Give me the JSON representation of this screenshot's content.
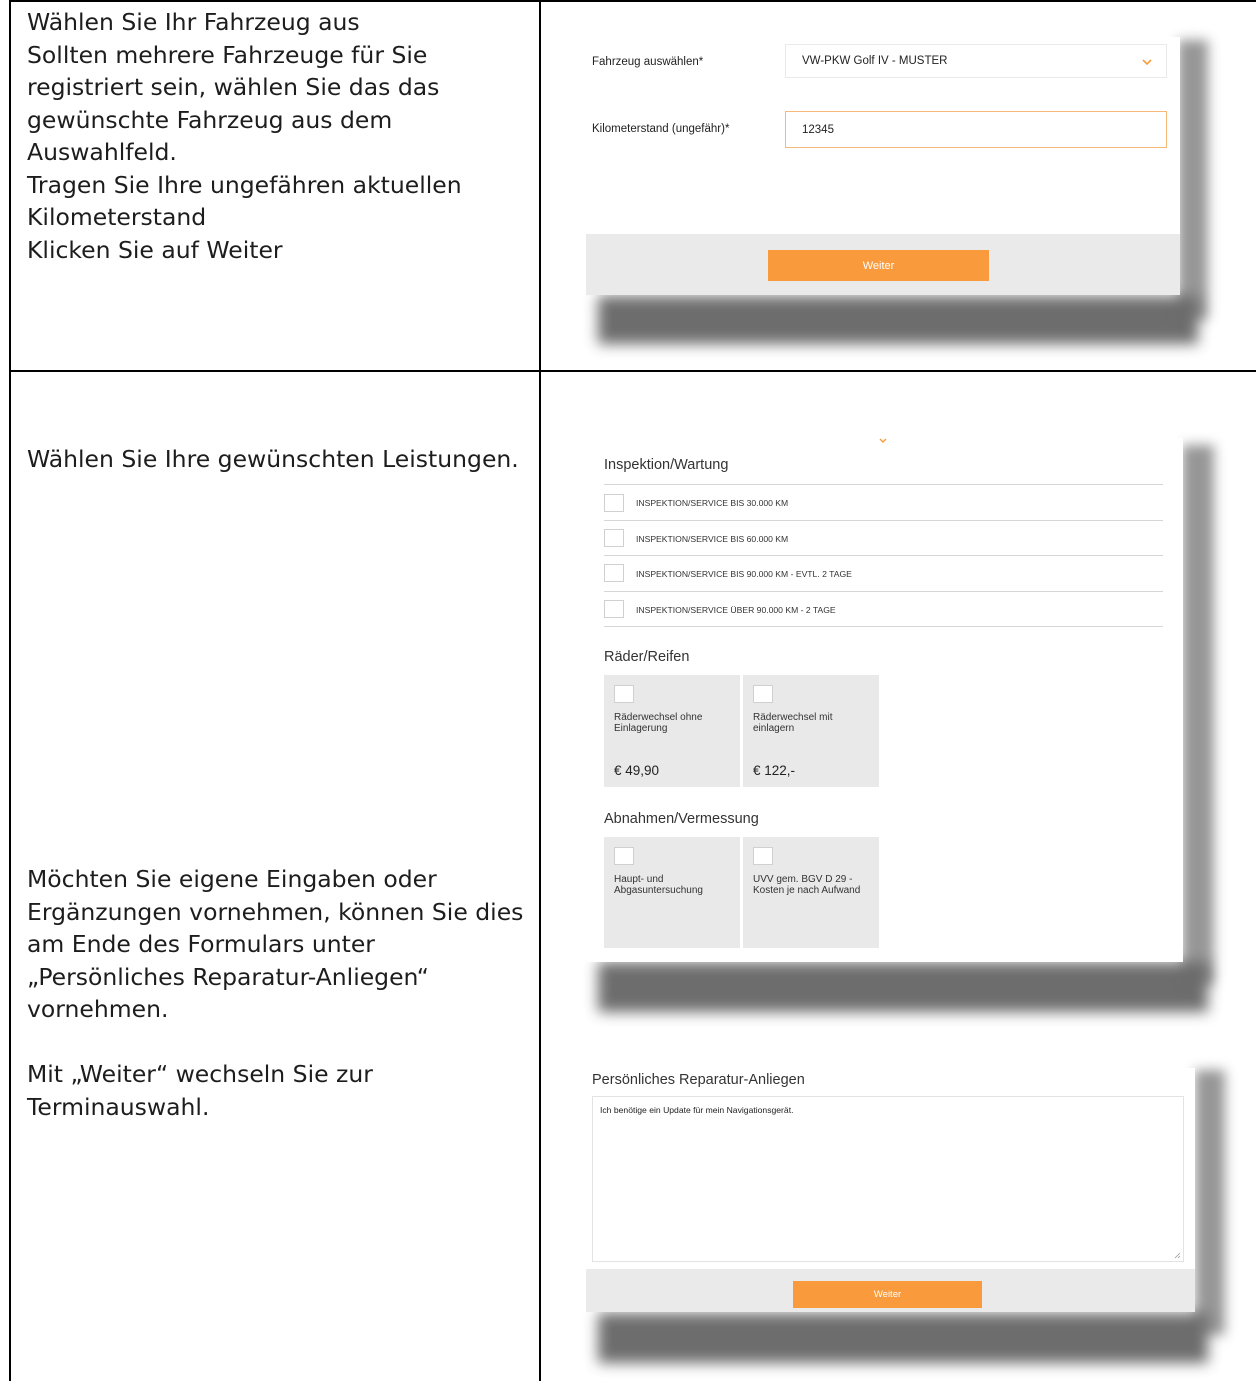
{
  "row1": {
    "instructions": [
      "Wählen Sie Ihr Fahrzeug aus",
      "Sollten mehrere Fahrzeuge für Sie",
      "registriert sein, wählen Sie das das",
      "gewünschte Fahrzeug aus dem",
      "Auswahlfeld.",
      "Tragen Sie Ihre ungefähren aktuellen",
      "Kilometerstand",
      "Klicken Sie auf Weiter"
    ],
    "form": {
      "vehicle_label": "Fahrzeug auswählen*",
      "vehicle_value": "VW-PKW Golf IV - MUSTER",
      "km_label": "Kilometerstand (ungefähr)*",
      "km_value": "12345",
      "next_label": "Weiter"
    }
  },
  "row2": {
    "instructions_top": [
      "Wählen Sie Ihre gewünschten Leistungen."
    ],
    "instructions_bottom": [
      "Möchten Sie eigene Eingaben oder",
      "Ergänzungen vornehmen, können Sie dies",
      "am Ende des Formulars unter",
      "„Persönliches Reparatur-Anliegen“",
      "vornehmen.",
      "",
      "Mit „Weiter“ wechseln Sie zur",
      "Terminauswahl."
    ],
    "services": {
      "inspection_title": "Inspektion/Wartung",
      "inspection_options": [
        "INSPEKTION/SERVICE BIS 30.000 KM",
        "INSPEKTION/SERVICE BIS 60.000 KM",
        "INSPEKTION/SERVICE BIS 90.000 KM - EVTL. 2 TAGE",
        "INSPEKTION/SERVICE ÜBER 90.000 KM - 2 TAGE"
      ],
      "wheels_title": "Räder/Reifen",
      "wheels_tiles": [
        {
          "label": "Räderwechsel ohne Einlagerung",
          "price": "€ 49,90"
        },
        {
          "label": "Räderwechsel mit einlagern",
          "price": "€ 122,-"
        }
      ],
      "inspections_title": "Abnahmen/Vermessung",
      "inspections_tiles": [
        {
          "label": "Haupt- und Abgasuntersuchung"
        },
        {
          "label": "UVV gem. BGV D 29 - Kosten je nach Aufwand"
        }
      ]
    },
    "repair": {
      "title": "Persönliches Reparatur-Anliegen",
      "text": "Ich benötige ein Update für mein Navigationsgerät.",
      "next_label": "Weiter"
    }
  }
}
